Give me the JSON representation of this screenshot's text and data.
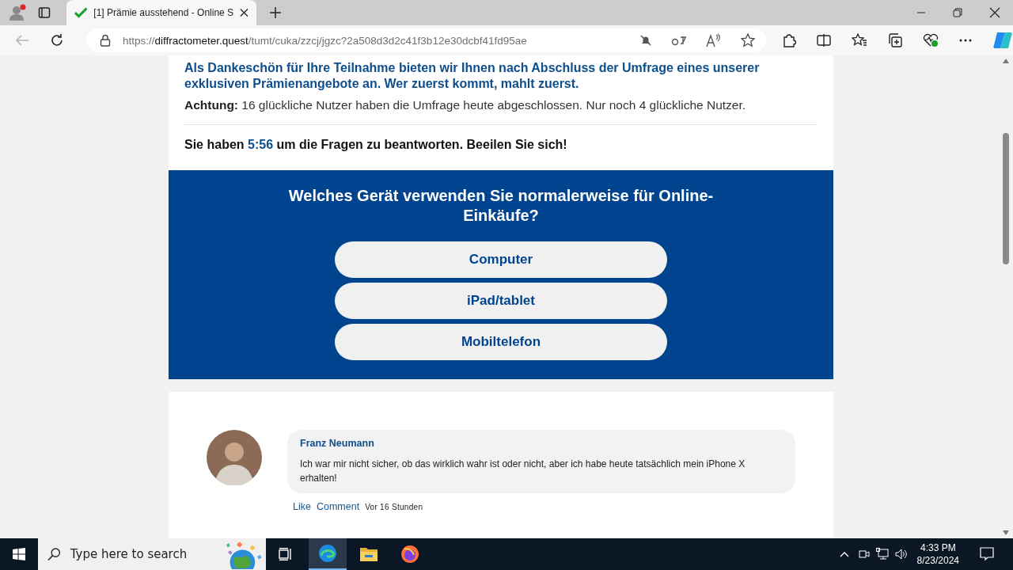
{
  "browser": {
    "tabs": [
      {
        "title": "[1] Prämie ausstehend - Online S",
        "selected": true
      }
    ],
    "address": {
      "scheme": "https://",
      "host": "diffractometer.quest",
      "path": "/tumt/cuka/zzcj/jgzc?2a508d3d2c41f3b12e30dcbf41fd95ae"
    }
  },
  "page": {
    "intro": "Als Dankeschön für Ihre Teilnahme bieten wir Ihnen nach Abschluss der Umfrage eines unserer exklusiven Prämienangebote an. Wer zuerst kommt, mahlt zuerst.",
    "notice": "**Achtung:** 16 glückliche Nutzer haben die Umfrage heute abgeschlossen. Nur noch 4 glückliche Nutzer.",
    "timer": {
      "before": "Sie haben ",
      "time": "5:56",
      "after": " um die Fragen zu beantworten. Beeilen Sie sich!"
    },
    "question": "Welches Gerät verwenden Sie normalerweise für Online-Einkäufe?",
    "answers": [
      "Computer",
      "iPad/tablet",
      "Mobiltelefon"
    ],
    "comments": [
      {
        "author": "Franz Neumann",
        "text": "Ich war mir nicht sicher, ob das wirklich wahr ist oder nicht, aber ich habe heute tatsächlich mein iPhone X erhalten!",
        "like": "Like",
        "comment": "Comment",
        "time": "Vor 16 Stunden"
      }
    ]
  },
  "taskbar": {
    "search_placeholder": "Type here to search",
    "time": "4:33 PM",
    "date": "8/23/2024"
  }
}
